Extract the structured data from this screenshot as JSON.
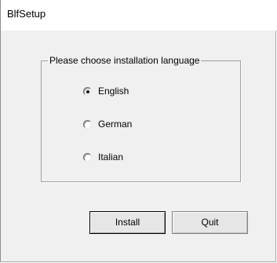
{
  "window": {
    "title": "BlfSetup"
  },
  "language_group": {
    "legend": "Please choose installation language",
    "options": [
      {
        "label": "English",
        "checked": true
      },
      {
        "label": "German",
        "checked": false
      },
      {
        "label": "Italian",
        "checked": false
      }
    ]
  },
  "buttons": {
    "install_label": "Install",
    "quit_label": "Quit"
  },
  "colors": {
    "title_background": "#ffffff",
    "dialog_background": "#f0f0f0",
    "button_face": "#e6e6e6",
    "group_border": "#a0a0a0"
  }
}
